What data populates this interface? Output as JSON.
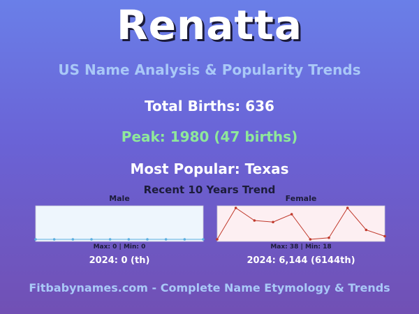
{
  "header": {
    "name": "Renatta",
    "subtitle": "US Name Analysis & Popularity Trends"
  },
  "stats": {
    "total_births": "Total Births: 636",
    "peak": "Peak: 1980 (47 births)",
    "most_popular": "Most Popular: Texas"
  },
  "trend": {
    "title": "Recent 10 Years Trend"
  },
  "male": {
    "label": "Male",
    "maxmin": "Max: 0 | Min: 0",
    "year_rank": "2024: 0 (th)"
  },
  "female": {
    "label": "Female",
    "maxmin": "Max: 38 | Min: 18",
    "year_rank": "2024: 6,144 (6144th)"
  },
  "footer": {
    "text": "Fitbabynames.com - Complete Name Etymology & Trends"
  },
  "colors": {
    "male_bg": "#eef6fd",
    "male_line": "#5aaee0",
    "female_bg": "#fdeff2",
    "female_line": "#c0392b"
  },
  "chart_data": [
    {
      "type": "line",
      "title": "Male",
      "values": [
        0,
        0,
        0,
        0,
        0,
        0,
        0,
        0,
        0,
        0
      ],
      "ylim": [
        0,
        0
      ]
    },
    {
      "type": "line",
      "title": "Female",
      "values": [
        18,
        38,
        30,
        29,
        34,
        18,
        19,
        38,
        24,
        20
      ],
      "ylim": [
        18,
        38
      ]
    }
  ]
}
